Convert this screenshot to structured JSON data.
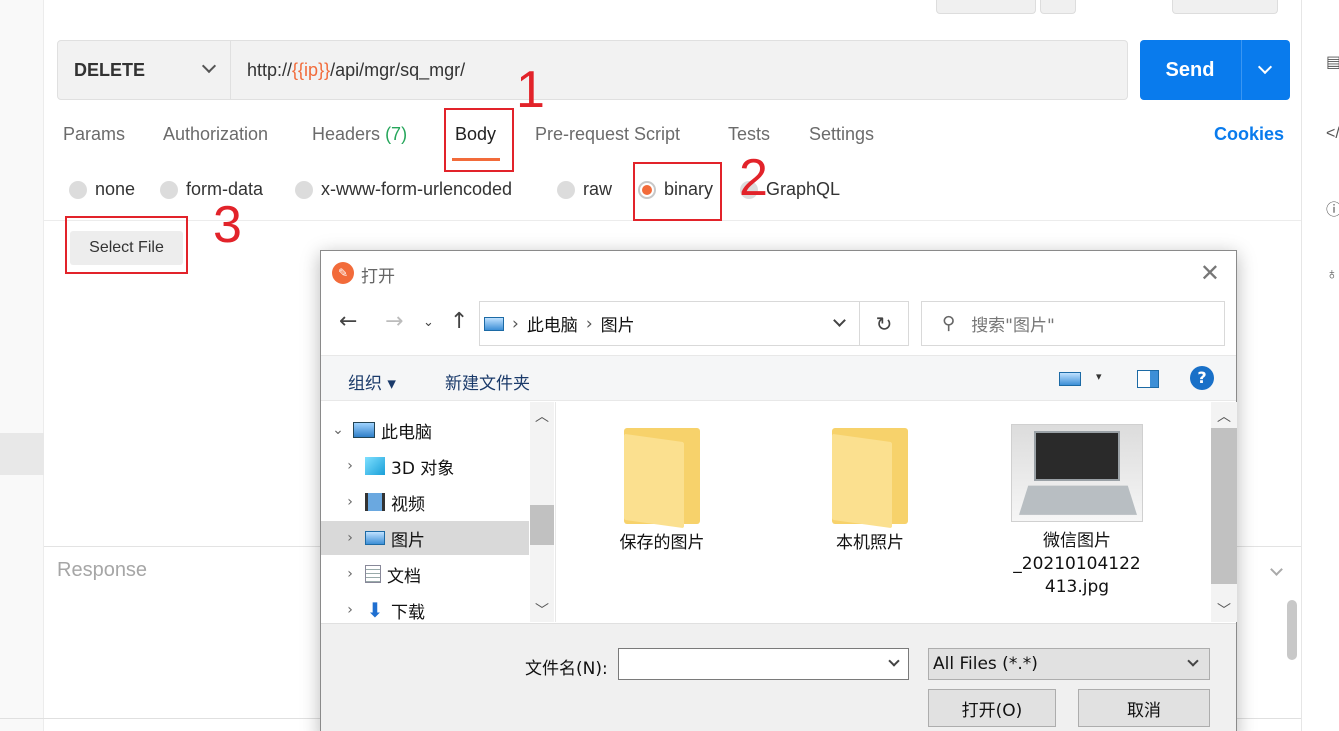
{
  "request": {
    "method": "DELETE",
    "url_prefix": "http://",
    "url_var": "{{ip}}",
    "url_suffix": "/api/mgr/sq_mgr/",
    "send_label": "Send"
  },
  "tabs": [
    {
      "label": "Params"
    },
    {
      "label": "Authorization"
    },
    {
      "label": "Headers",
      "count": "(7)"
    },
    {
      "label": "Body",
      "active": true
    },
    {
      "label": "Pre-request Script"
    },
    {
      "label": "Tests"
    },
    {
      "label": "Settings"
    }
  ],
  "cookies_label": "Cookies",
  "body_types": [
    {
      "label": "none",
      "selected": false
    },
    {
      "label": "form-data",
      "selected": false
    },
    {
      "label": "x-www-form-urlencoded",
      "selected": false
    },
    {
      "label": "raw",
      "selected": false
    },
    {
      "label": "binary",
      "selected": true
    },
    {
      "label": "GraphQL",
      "selected": false
    }
  ],
  "select_file_label": "Select File",
  "response_label": "Response",
  "annotations": [
    "1",
    "2",
    "3"
  ],
  "colors": {
    "accent": "#f26b3a",
    "send": "#097bed",
    "annotation": "#e2232a"
  },
  "dialog": {
    "title": "打开",
    "breadcrumb": [
      "此电脑",
      "图片"
    ],
    "search_placeholder": "搜索\"图片\"",
    "toolbar": {
      "organize": "组织 ▾",
      "new_folder": "新建文件夹"
    },
    "tree": [
      {
        "label": "此电脑",
        "icon": "computer-icon",
        "expanded": true
      },
      {
        "label": "3D 对象",
        "icon": "cube-icon"
      },
      {
        "label": "视频",
        "icon": "video-icon"
      },
      {
        "label": "图片",
        "icon": "pictures-icon",
        "selected": true
      },
      {
        "label": "文档",
        "icon": "document-icon"
      },
      {
        "label": "下载",
        "icon": "download-icon"
      }
    ],
    "files": [
      {
        "name": "保存的图片",
        "kind": "folder"
      },
      {
        "name": "本机照片",
        "kind": "folder"
      },
      {
        "name_lines": [
          "微信图片",
          "_20210104122",
          "413.jpg"
        ],
        "kind": "image"
      }
    ],
    "filename_label": "文件名(N):",
    "filename_value": "",
    "filter_value": "All Files (*.*)",
    "open_label": "打开(O)",
    "cancel_label": "取消"
  }
}
